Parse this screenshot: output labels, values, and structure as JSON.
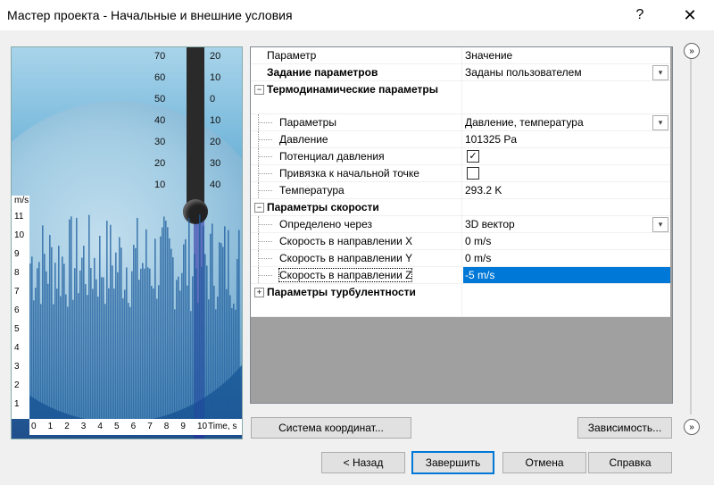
{
  "window": {
    "title": "Мастер проекта - Начальные и внешние условия",
    "help_glyph": "?",
    "close_glyph": "✕"
  },
  "image_panel": {
    "celsius_ticks": [
      "70",
      "60",
      "50",
      "40",
      "30",
      "20",
      "10"
    ],
    "fahrenheit_ticks": [
      "20",
      "10",
      "0",
      "10",
      "20",
      "30",
      "40"
    ],
    "x_axis_ticks": [
      "0",
      "1",
      "2",
      "3",
      "4",
      "5",
      "6",
      "7",
      "8",
      "9",
      "10"
    ],
    "x_axis_label": "Time, s",
    "y_axis_label": "m/s",
    "y_axis_ticks": [
      "11",
      "10",
      "9",
      "8",
      "7",
      "6",
      "5",
      "4",
      "3",
      "2",
      "1"
    ],
    "gauge_text": "Thermometer"
  },
  "grid": {
    "header": {
      "name": "Параметр",
      "value": "Значение"
    },
    "rows": [
      {
        "name": "Задание параметров",
        "value": "Заданы пользователем",
        "bold": true,
        "dropdown": true
      },
      {
        "name": "Термодинамические параметры",
        "value": "",
        "group": true,
        "expanded": true
      },
      {
        "name": "Параметры",
        "value": "Давление, температура",
        "dropdown": true,
        "child": true
      },
      {
        "name": "Давление",
        "value": "101325 Pa",
        "child": true
      },
      {
        "name": "Потенциал давления",
        "checked": true,
        "child": true
      },
      {
        "name": "Привязка к начальной точке",
        "checked": false,
        "child": true
      },
      {
        "name": "Температура",
        "value": "293.2 K",
        "child": true
      },
      {
        "name": "Параметры скорости",
        "group": true,
        "expanded": true
      },
      {
        "name": "Определено через",
        "value": "3D вектор",
        "dropdown": true,
        "child": true
      },
      {
        "name": "Скорость в направлении X",
        "value": "0 m/s",
        "child": true
      },
      {
        "name": "Скорость в направлении Y",
        "value": "0 m/s",
        "child": true
      },
      {
        "name": "Скорость в направлении Z",
        "value": "-5 m/s",
        "child": true,
        "selected": true
      },
      {
        "name": "Параметры турбулентности",
        "group": true,
        "expanded": false
      }
    ],
    "check_glyph": "✓",
    "dropdown_glyph": "▾",
    "expanded_glyph": "−",
    "collapsed_glyph": "+"
  },
  "side_toggle_glyph": "»",
  "buttons": {
    "coord_system": "Система координат...",
    "dependency": "Зависимость...",
    "back": "< Назад",
    "finish": "Завершить",
    "cancel": "Отмена",
    "help": "Справка"
  },
  "colors": {
    "selection": "#0078d7",
    "dialog_bg": "#f0f0f0",
    "grid_empty": "#a0a0a0"
  }
}
